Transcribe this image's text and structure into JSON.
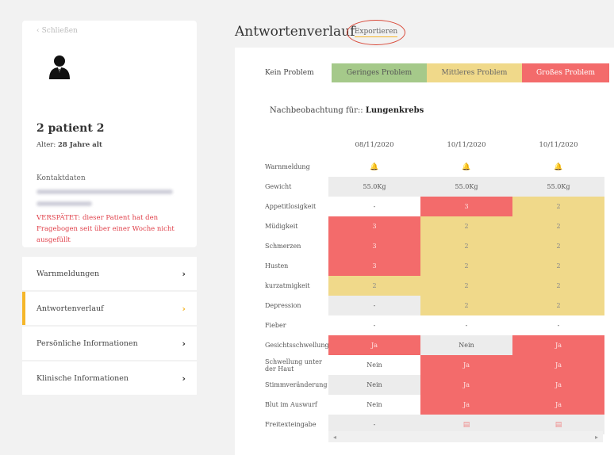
{
  "sidebar": {
    "close_label": "Schließen",
    "patient_name": "2 patient 2",
    "age_label": "Alter:",
    "age_value": "28 Jahre alt",
    "contact_label": "Kontaktdaten",
    "warning": "VERSPÄTET: dieser Patient hat den Fragebogen seit über einer Woche nicht ausgefüllt",
    "nav": [
      {
        "label": "Warnmeldungen",
        "active": false
      },
      {
        "label": "Antwortenverlauf",
        "active": true
      },
      {
        "label": "Persönliche Informationen",
        "active": false
      },
      {
        "label": "Klinische Informationen",
        "active": false
      }
    ]
  },
  "main": {
    "title": "Antwortenverlauf",
    "export_label": "Exportieren",
    "legend": {
      "none": "Kein Problem",
      "small": "Geringes Problem",
      "medium": "Mittleres Problem",
      "big": "Großes Problem"
    },
    "followup_prefix": "Nachbeobachtung für::",
    "followup_value": "Lungenkrebs",
    "columns": [
      "08/11/2020",
      "10/11/2020",
      "10/11/2020"
    ],
    "rows": [
      {
        "label": "Warnmeldung",
        "cells": [
          {
            "v": "",
            "icon": "bell"
          },
          {
            "v": "",
            "icon": "bell"
          },
          {
            "v": "",
            "icon": "bell"
          }
        ],
        "bg": [
          "white",
          "white",
          "white"
        ]
      },
      {
        "label": "Gewicht",
        "cells": [
          {
            "v": "55.0Kg"
          },
          {
            "v": "55.0Kg"
          },
          {
            "v": "55.0Kg"
          }
        ],
        "bg": [
          "grey",
          "grey",
          "grey"
        ]
      },
      {
        "label": "Appetitlosigkeit",
        "cells": [
          {
            "v": "-"
          },
          {
            "v": "3"
          },
          {
            "v": "2"
          }
        ],
        "bg": [
          "white",
          "red",
          "yellow"
        ]
      },
      {
        "label": "Müdigkeit",
        "cells": [
          {
            "v": "3"
          },
          {
            "v": "2"
          },
          {
            "v": "2"
          }
        ],
        "bg": [
          "red",
          "yellow",
          "yellow"
        ]
      },
      {
        "label": "Schmerzen",
        "cells": [
          {
            "v": "3"
          },
          {
            "v": "2"
          },
          {
            "v": "2"
          }
        ],
        "bg": [
          "red",
          "yellow",
          "yellow"
        ]
      },
      {
        "label": "Husten",
        "cells": [
          {
            "v": "3"
          },
          {
            "v": "2"
          },
          {
            "v": "2"
          }
        ],
        "bg": [
          "red",
          "yellow",
          "yellow"
        ]
      },
      {
        "label": "kurzatmigkeit",
        "cells": [
          {
            "v": "2"
          },
          {
            "v": "2"
          },
          {
            "v": "2"
          }
        ],
        "bg": [
          "yellow",
          "yellow",
          "yellow"
        ]
      },
      {
        "label": "Depression",
        "cells": [
          {
            "v": "-"
          },
          {
            "v": "2"
          },
          {
            "v": "2"
          }
        ],
        "bg": [
          "grey",
          "yellow",
          "yellow"
        ]
      },
      {
        "label": "Fieber",
        "cells": [
          {
            "v": "-"
          },
          {
            "v": "-"
          },
          {
            "v": "-"
          }
        ],
        "bg": [
          "white",
          "white",
          "white"
        ]
      },
      {
        "label": "Gesichtsschwellung",
        "cells": [
          {
            "v": "Ja"
          },
          {
            "v": "Nein"
          },
          {
            "v": "Ja"
          }
        ],
        "bg": [
          "red",
          "grey",
          "red"
        ]
      },
      {
        "label": "Schwellung unter der Haut",
        "cells": [
          {
            "v": "Nein"
          },
          {
            "v": "Ja"
          },
          {
            "v": "Ja"
          }
        ],
        "bg": [
          "white",
          "red",
          "red"
        ]
      },
      {
        "label": "Stimmveränderung",
        "cells": [
          {
            "v": "Nein"
          },
          {
            "v": "Ja"
          },
          {
            "v": "Ja"
          }
        ],
        "bg": [
          "grey",
          "red",
          "red"
        ]
      },
      {
        "label": "Blut im Auswurf",
        "cells": [
          {
            "v": "Nein"
          },
          {
            "v": "Ja"
          },
          {
            "v": "Ja"
          }
        ],
        "bg": [
          "white",
          "red",
          "red"
        ]
      },
      {
        "label": "Freitexteingabe",
        "cells": [
          {
            "v": "-"
          },
          {
            "v": "",
            "icon": "chat"
          },
          {
            "v": "",
            "icon": "chat"
          }
        ],
        "bg": [
          "grey",
          "grey",
          "grey"
        ]
      }
    ]
  },
  "colors": {
    "red": "#f36b6b",
    "yellow": "#f0d98a",
    "green": "#a5c98a",
    "accent": "#f5b62a",
    "warning": "#e0404a"
  }
}
